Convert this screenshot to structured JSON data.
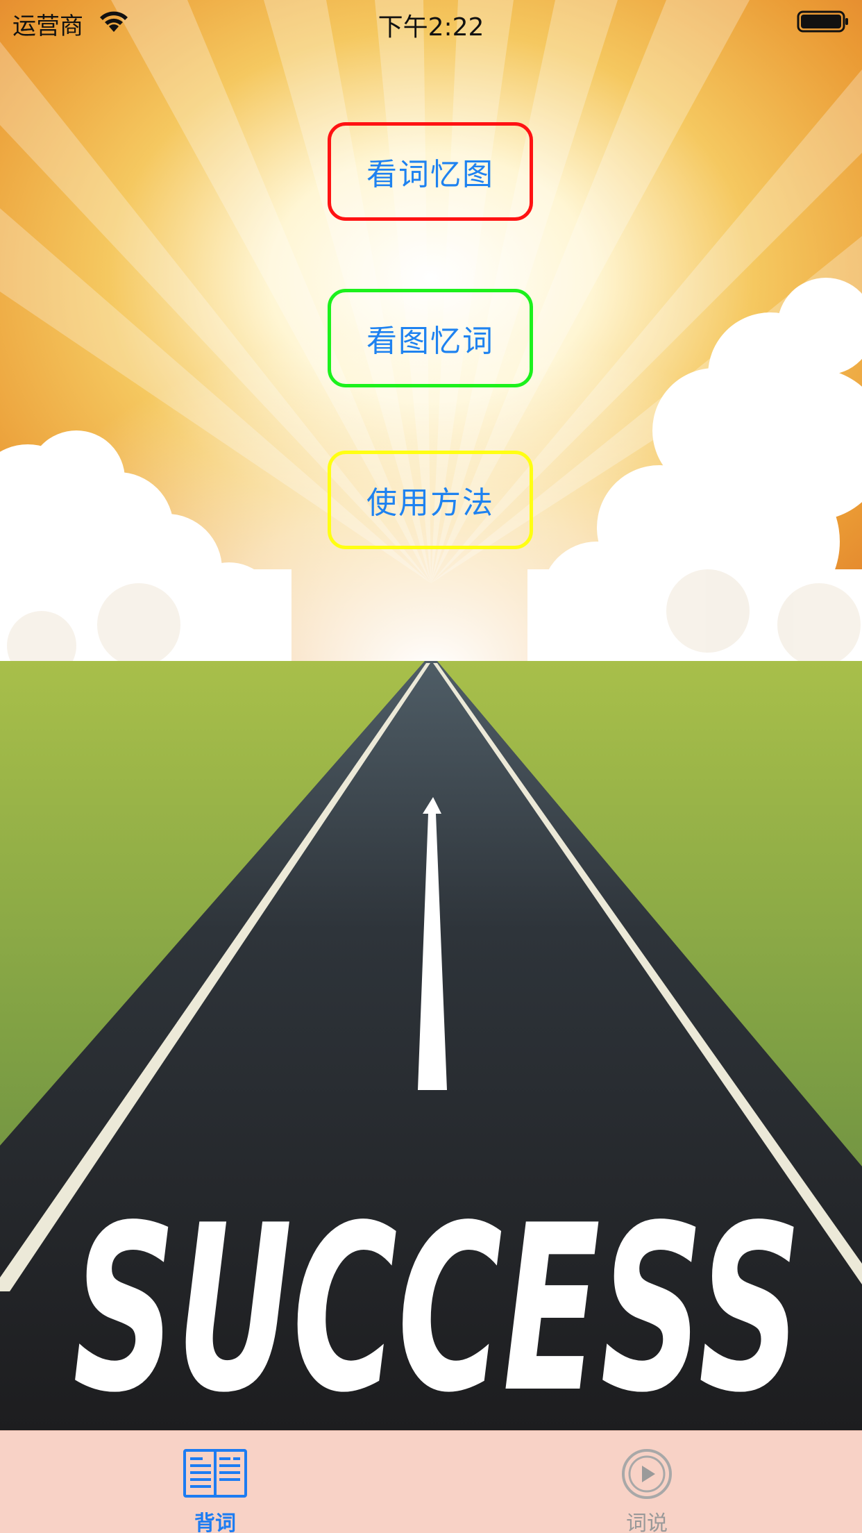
{
  "status_bar": {
    "carrier": "运营商",
    "time": "下午2:22"
  },
  "illustration": {
    "road_text": "SUCCESS"
  },
  "menu": {
    "buttons": [
      {
        "label": "看词忆图",
        "border_color": "#ff1212"
      },
      {
        "label": "看图忆词",
        "border_color": "#1cf11c"
      },
      {
        "label": "使用方法",
        "border_color": "#ffff12"
      }
    ],
    "text_color": "#1e82f0"
  },
  "tab_bar": {
    "background": "#f8d2c6",
    "items": [
      {
        "label": "背词",
        "icon": "book-icon",
        "selected": true
      },
      {
        "label": "词说",
        "icon": "play-circle-icon",
        "selected": false
      }
    ],
    "active_color": "#1d7cf2",
    "inactive_color": "#999999"
  }
}
